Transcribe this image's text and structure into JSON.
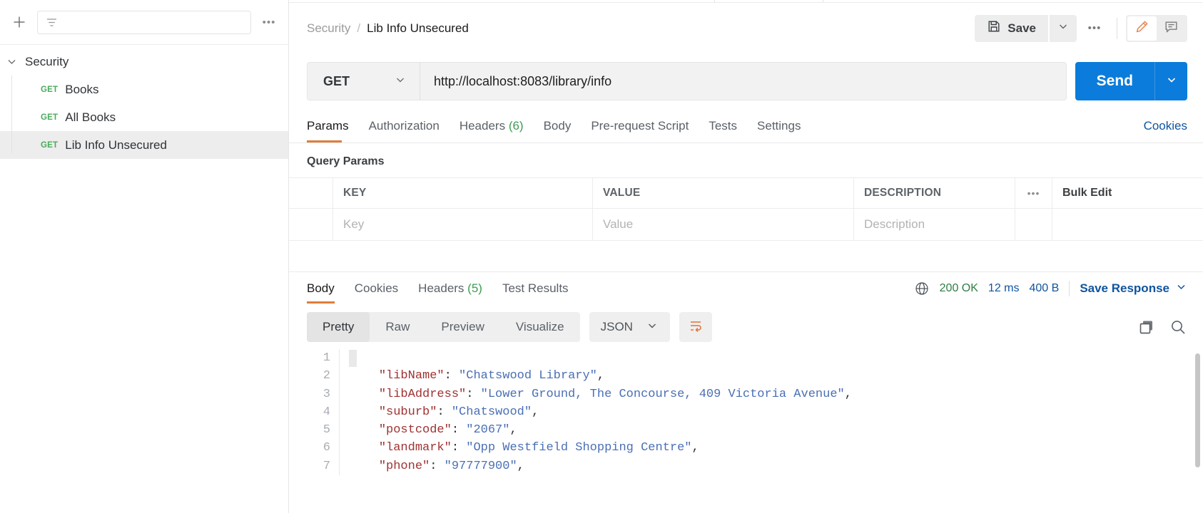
{
  "sidebar": {
    "add_label": "+",
    "filter_placeholder": "",
    "more_label": "•••",
    "folder": {
      "label": "Security"
    },
    "items": [
      {
        "method": "GET",
        "name": "Books",
        "selected": false
      },
      {
        "method": "GET",
        "name": "All Books",
        "selected": false
      },
      {
        "method": "GET",
        "name": "Lib Info Unsecured",
        "selected": true
      }
    ]
  },
  "header": {
    "breadcrumb_parent": "Security",
    "breadcrumb_sep": "/",
    "breadcrumb_current": "Lib Info Unsecured",
    "save_label": "Save",
    "more_label": "•••"
  },
  "request": {
    "method": "GET",
    "url": "http://localhost:8083/library/info",
    "send_label": "Send",
    "tabs": [
      {
        "label": "Params",
        "count": "",
        "active": true
      },
      {
        "label": "Authorization",
        "count": "",
        "active": false
      },
      {
        "label": "Headers",
        "count": "(6)",
        "active": false
      },
      {
        "label": "Body",
        "count": "",
        "active": false
      },
      {
        "label": "Pre-request Script",
        "count": "",
        "active": false
      },
      {
        "label": "Tests",
        "count": "",
        "active": false
      },
      {
        "label": "Settings",
        "count": "",
        "active": false
      }
    ],
    "cookies_link": "Cookies"
  },
  "query_params": {
    "title": "Query Params",
    "columns": [
      "KEY",
      "VALUE",
      "DESCRIPTION"
    ],
    "more_label": "•••",
    "bulk_edit_label": "Bulk Edit",
    "row_placeholders": [
      "Key",
      "Value",
      "Description"
    ]
  },
  "response": {
    "tabs": [
      {
        "label": "Body",
        "count": "",
        "active": true
      },
      {
        "label": "Cookies",
        "count": "",
        "active": false
      },
      {
        "label": "Headers",
        "count": "(5)",
        "active": false
      },
      {
        "label": "Test Results",
        "count": "",
        "active": false
      }
    ],
    "status": "200 OK",
    "time": "12 ms",
    "size": "400 B",
    "save_response_label": "Save Response",
    "format_tabs": [
      {
        "label": "Pretty",
        "active": true
      },
      {
        "label": "Raw",
        "active": false
      },
      {
        "label": "Preview",
        "active": false
      },
      {
        "label": "Visualize",
        "active": false
      }
    ],
    "content_type": "JSON",
    "body_lines": [
      {
        "n": "1",
        "segments": [
          {
            "t": "pun",
            "v": "{"
          }
        ]
      },
      {
        "n": "2",
        "segments": [
          {
            "t": "pun",
            "v": "    "
          },
          {
            "t": "key",
            "v": "\"libName\""
          },
          {
            "t": "pun",
            "v": ": "
          },
          {
            "t": "str",
            "v": "\"Chatswood Library\""
          },
          {
            "t": "pun",
            "v": ","
          }
        ]
      },
      {
        "n": "3",
        "segments": [
          {
            "t": "pun",
            "v": "    "
          },
          {
            "t": "key",
            "v": "\"libAddress\""
          },
          {
            "t": "pun",
            "v": ": "
          },
          {
            "t": "str",
            "v": "\"Lower Ground, The Concourse, 409 Victoria Avenue\""
          },
          {
            "t": "pun",
            "v": ","
          }
        ]
      },
      {
        "n": "4",
        "segments": [
          {
            "t": "pun",
            "v": "    "
          },
          {
            "t": "key",
            "v": "\"suburb\""
          },
          {
            "t": "pun",
            "v": ": "
          },
          {
            "t": "str",
            "v": "\"Chatswood\""
          },
          {
            "t": "pun",
            "v": ","
          }
        ]
      },
      {
        "n": "5",
        "segments": [
          {
            "t": "pun",
            "v": "    "
          },
          {
            "t": "key",
            "v": "\"postcode\""
          },
          {
            "t": "pun",
            "v": ": "
          },
          {
            "t": "str",
            "v": "\"2067\""
          },
          {
            "t": "pun",
            "v": ","
          }
        ]
      },
      {
        "n": "6",
        "segments": [
          {
            "t": "pun",
            "v": "    "
          },
          {
            "t": "key",
            "v": "\"landmark\""
          },
          {
            "t": "pun",
            "v": ": "
          },
          {
            "t": "str",
            "v": "\"Opp Westfield Shopping Centre\""
          },
          {
            "t": "pun",
            "v": ","
          }
        ]
      },
      {
        "n": "7",
        "segments": [
          {
            "t": "pun",
            "v": "    "
          },
          {
            "t": "key",
            "v": "\"phone\""
          },
          {
            "t": "pun",
            "v": ": "
          },
          {
            "t": "str",
            "v": "\"97777900\""
          },
          {
            "t": "pun",
            "v": ","
          }
        ]
      }
    ]
  },
  "colors": {
    "accent_orange": "#e07d3a",
    "send_blue": "#0b7cdb",
    "link_blue": "#10549e",
    "status_green": "#2e7d46",
    "method_green": "#4aab5b"
  }
}
